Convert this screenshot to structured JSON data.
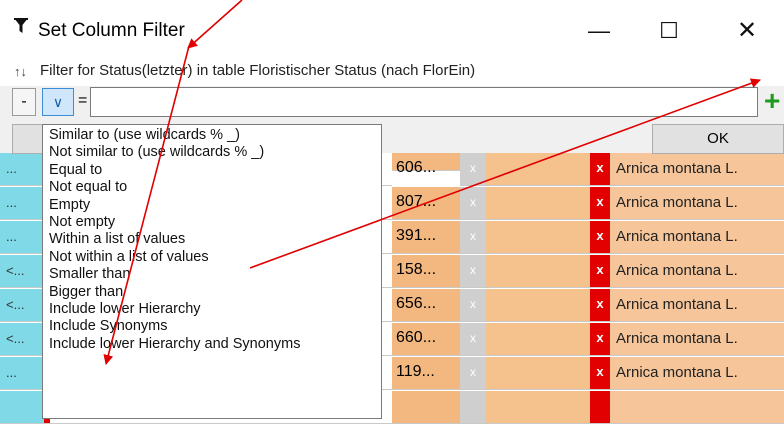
{
  "dialog": {
    "title": "Set Column Filter",
    "filter_description": "Filter for Status(letzter) in table Floristischer Status (nach FlorEin)",
    "sort_glyph": "↑↓",
    "minus_label": "-",
    "dropdown_glyph": "∨",
    "equals_label": "=",
    "input_value": "",
    "add_glyph": "+",
    "ok_label": "OK",
    "window_buttons": {
      "minimize": "—",
      "maximize": "☐",
      "close": "✕"
    }
  },
  "operator_options": [
    "Similar to (use wildcards % _)",
    "Not similar to (use wildcards % _)",
    "Equal to",
    "Not equal to",
    "Empty",
    "Not empty",
    "Within a list of values",
    "Not within a list of values",
    "Smaller than",
    "Bigger than",
    "Include lower Hierarchy",
    "Include Synonyms",
    "Include lower Hierarchy and Synonyms"
  ],
  "background_rows": [
    {
      "dots": "...",
      "num": "606...",
      "gray": "x",
      "flag": "x",
      "name": "Arnica montana L."
    },
    {
      "dots": "...",
      "num": "807...",
      "gray": "x",
      "flag": "x",
      "name": "Arnica montana L."
    },
    {
      "dots": "...",
      "num": "391...",
      "gray": "x",
      "flag": "x",
      "name": "Arnica montana L."
    },
    {
      "dots": "<...",
      "num": "158...",
      "gray": "x",
      "flag": "x",
      "name": "Arnica montana L."
    },
    {
      "dots": "<...",
      "num": "656...",
      "gray": "x",
      "flag": "x",
      "name": "Arnica montana L."
    },
    {
      "dots": "<...",
      "num": "660...",
      "gray": "x",
      "flag": "x",
      "name": "Arnica montana L."
    },
    {
      "dots": "...",
      "num": "119...",
      "gray": "x",
      "flag": "x",
      "name": "Arnica montana L."
    }
  ],
  "colors": {
    "annotation_arrow": "#e00000",
    "cyan_cell": "#7fd9e6",
    "red_flag": "#e30000",
    "orange_cell": "#f5c28e",
    "add_icon": "#1e9a1e"
  }
}
